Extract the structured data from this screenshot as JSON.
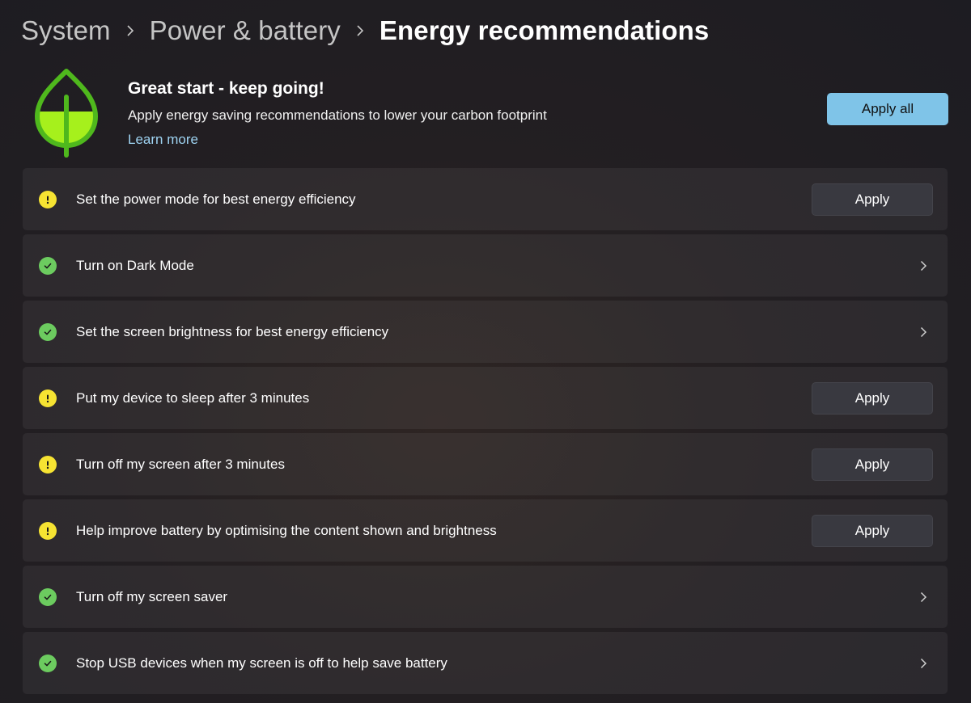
{
  "breadcrumb": {
    "items": [
      "System",
      "Power & battery",
      "Energy recommendations"
    ]
  },
  "hero": {
    "icon": "leaf-icon",
    "title": "Great start - keep going!",
    "description": "Apply energy saving recommendations to lower your carbon footprint",
    "link": "Learn more",
    "apply_all_label": "Apply all"
  },
  "colors": {
    "warning": "#f6e332",
    "success": "#6ccb5f",
    "accent": "#7fc4e8",
    "link": "#9fd4f3"
  },
  "recommendations": [
    {
      "label": "Set the power mode for best energy efficiency",
      "status": "warning",
      "action": "button",
      "button_label": "Apply"
    },
    {
      "label": "Turn on Dark Mode",
      "status": "done",
      "action": "chevron"
    },
    {
      "label": "Set the screen brightness for best energy efficiency",
      "status": "done",
      "action": "chevron"
    },
    {
      "label": "Put my device to sleep after 3 minutes",
      "status": "warning",
      "action": "button",
      "button_label": "Apply"
    },
    {
      "label": "Turn off my screen after 3 minutes",
      "status": "warning",
      "action": "button",
      "button_label": "Apply"
    },
    {
      "label": "Help improve battery by optimising the content shown and brightness",
      "status": "warning",
      "action": "button",
      "button_label": "Apply"
    },
    {
      "label": "Turn off my screen saver",
      "status": "done",
      "action": "chevron"
    },
    {
      "label": "Stop USB devices when my screen is off to help save battery",
      "status": "done",
      "action": "chevron"
    }
  ]
}
